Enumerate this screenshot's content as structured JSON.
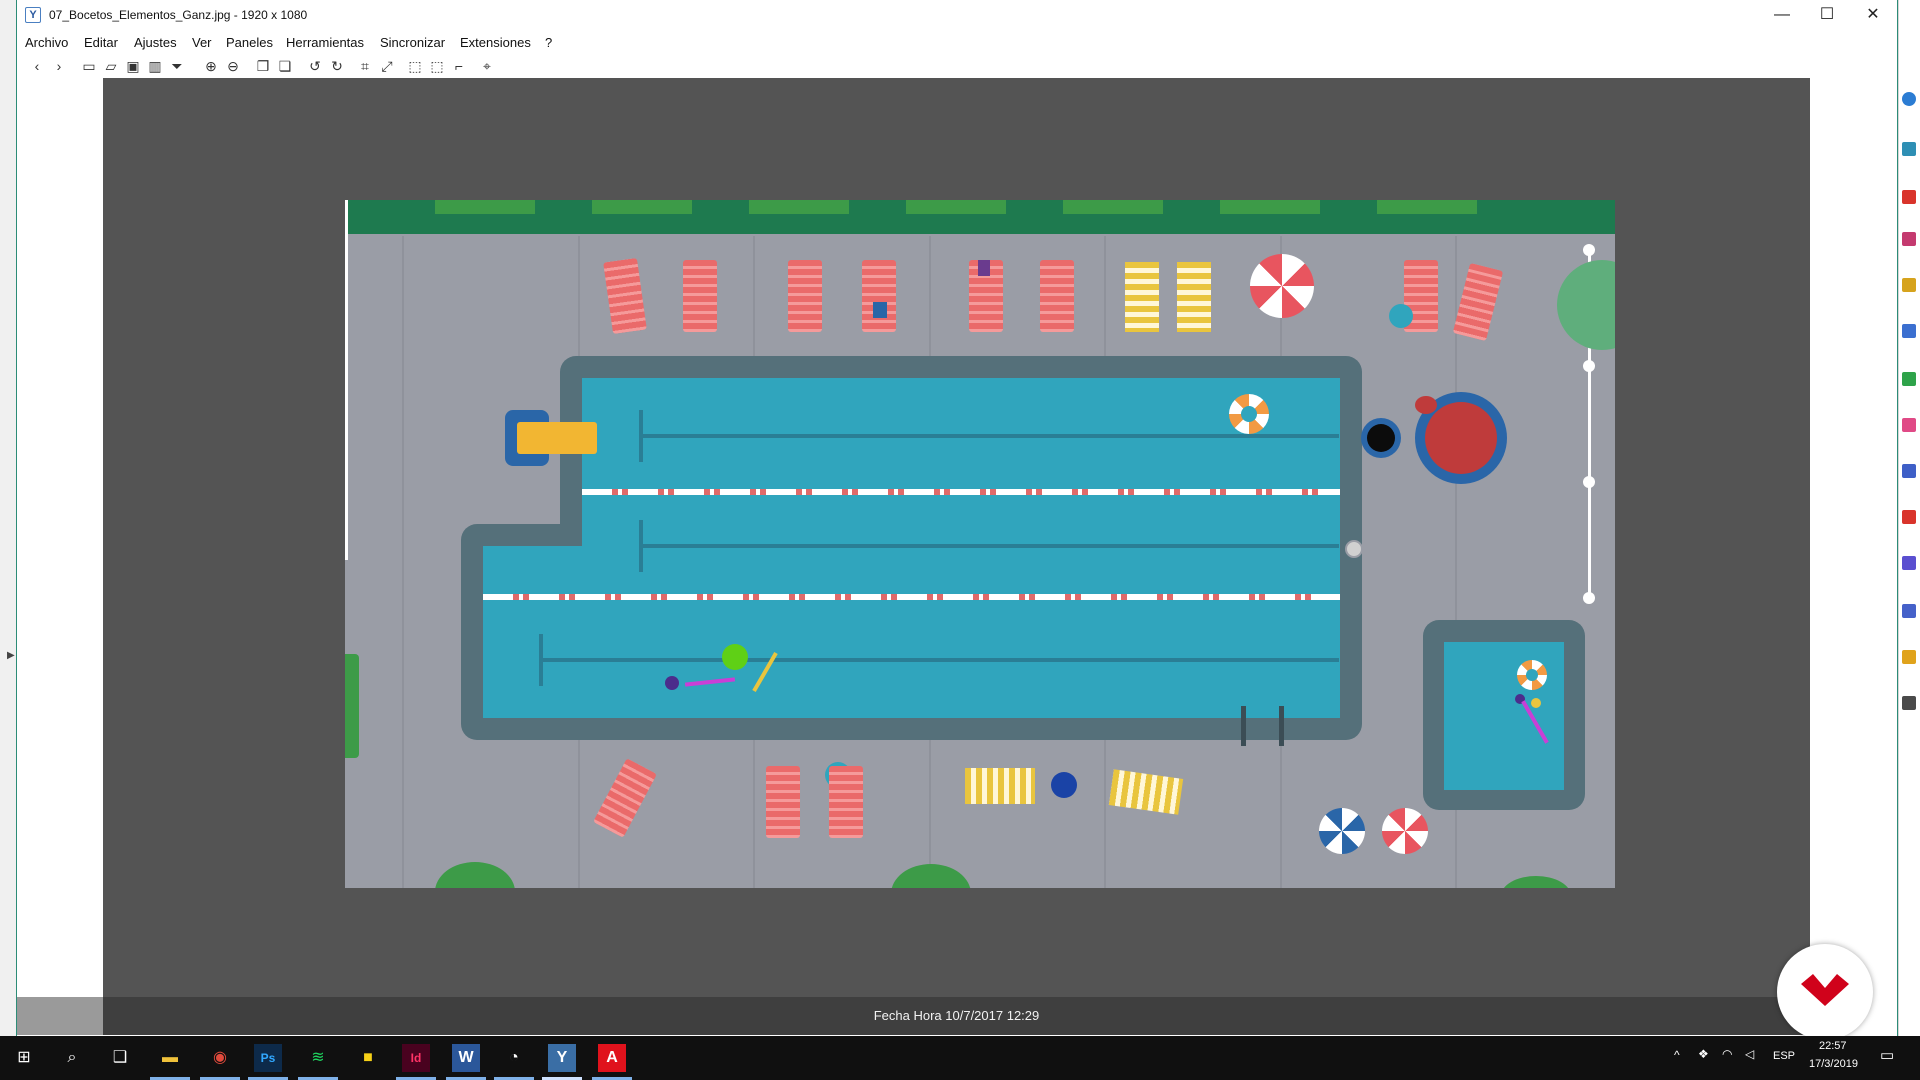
{
  "window": {
    "title": "07_Bocetos_Elementos_Ganz.jpg  - 1920 x 1080",
    "controls": {
      "minimize": "—",
      "maximize": "☐",
      "close": "✕"
    }
  },
  "menu": [
    "Archivo",
    "Editar",
    "Ajustes",
    "Ver",
    "Paneles",
    "Herramientas",
    "Sincronizar",
    "Extensiones",
    "?"
  ],
  "toolbar": [
    {
      "name": "back",
      "icon": "‹"
    },
    {
      "name": "forward",
      "icon": "›"
    },
    {
      "name": "new",
      "icon": "▭"
    },
    {
      "name": "open",
      "icon": "▱"
    },
    {
      "name": "save",
      "icon": "▣"
    },
    {
      "name": "delete",
      "icon": "▥"
    },
    {
      "name": "filter",
      "icon": "⏷"
    },
    {
      "name": "zoom-in",
      "icon": "⊕"
    },
    {
      "name": "zoom-out",
      "icon": "⊖"
    },
    {
      "name": "copy",
      "icon": "❐"
    },
    {
      "name": "paste",
      "icon": "❏"
    },
    {
      "name": "rotate-left",
      "icon": "↺"
    },
    {
      "name": "rotate-right",
      "icon": "↻"
    },
    {
      "name": "crop",
      "icon": "⌗"
    },
    {
      "name": "resize",
      "icon": "⤢"
    },
    {
      "name": "select",
      "icon": "⬚"
    },
    {
      "name": "select-alt",
      "icon": "⬚"
    },
    {
      "name": "measure",
      "icon": "⌐"
    },
    {
      "name": "location",
      "icon": "⌖"
    }
  ],
  "status": {
    "datetime": "Fecha Hora  10/7/2017 12:29"
  },
  "taskbar": {
    "apps": [
      "start",
      "search",
      "task-view",
      "file-explorer",
      "chrome",
      "photoshop",
      "spotify",
      "sticky-notes",
      "indesign",
      "word",
      "obs",
      "image-viewer",
      "acrobat"
    ],
    "labels": {
      "start": "⊞",
      "search": "⌕",
      "task-view": "❑",
      "file-explorer": "▬",
      "chrome": "◉",
      "photoshop": "Ps",
      "spotify": "≋",
      "sticky-notes": "■",
      "indesign": "Id",
      "word": "W",
      "obs": "◔",
      "image-viewer": "Y",
      "acrobat": "A"
    },
    "tray": {
      "language": "ESP",
      "time": "22:57",
      "date": "17/3/2019"
    }
  },
  "colors": {
    "viewer_bg": "#545454",
    "pool_water": "#30a5bd",
    "pool_coping": "#55707a",
    "deck": "#9a9da6",
    "hedge": "#1e7a4f",
    "lounger": "#ea6a6a",
    "towel": "#e9c53e",
    "logo": "#d0021b"
  }
}
